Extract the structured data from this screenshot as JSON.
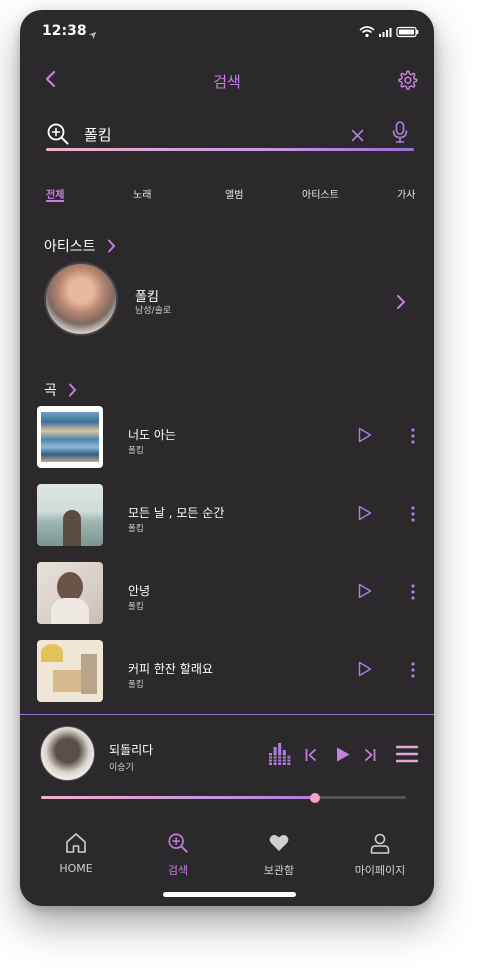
{
  "status_bar": {
    "time": "12:38"
  },
  "header": {
    "title": "검색"
  },
  "search": {
    "query": "폴킴"
  },
  "tabs": [
    {
      "label": "전체",
      "active": true
    },
    {
      "label": "노래",
      "active": false
    },
    {
      "label": "앨범",
      "active": false
    },
    {
      "label": "아티스트",
      "active": false
    },
    {
      "label": "가사",
      "active": false
    }
  ],
  "artist_section": {
    "title": "아티스트",
    "artist": {
      "name": "폴킴",
      "subtitle": "남성/솔로"
    }
  },
  "songs_section": {
    "title": "곡",
    "songs": [
      {
        "title": "너도 아는",
        "artist": "폴킴"
      },
      {
        "title": "모든 날 , 모든 순간",
        "artist": "폴킴"
      },
      {
        "title": "안녕",
        "artist": "폴킴"
      },
      {
        "title": "커피 한잔 할래요",
        "artist": "폴킴"
      }
    ]
  },
  "now_playing": {
    "title": "되돌리다",
    "artist": "이승기",
    "progress": 0.75
  },
  "bottom_nav": [
    {
      "label": "HOME",
      "icon": "home-icon",
      "active": false
    },
    {
      "label": "검색",
      "icon": "search-icon",
      "active": true
    },
    {
      "label": "보관함",
      "icon": "heart-icon",
      "active": false
    },
    {
      "label": "마이페이지",
      "icon": "user-icon",
      "active": false
    }
  ],
  "colors": {
    "accent": "#c57fe0",
    "background": "#2b292c",
    "progress_knob": "#f7a1c4"
  }
}
